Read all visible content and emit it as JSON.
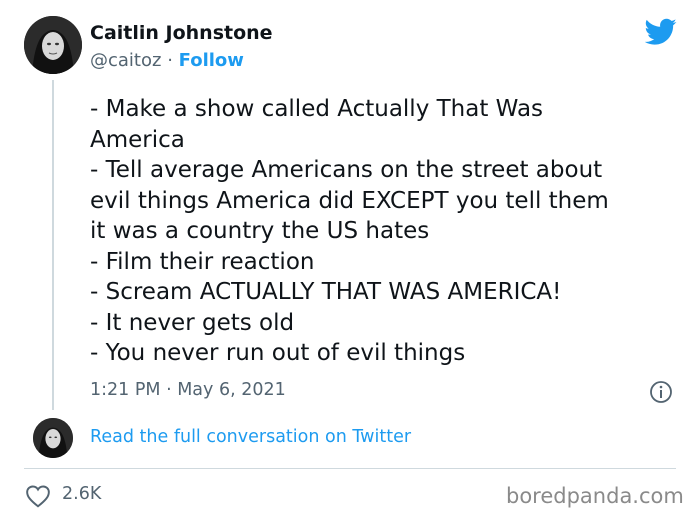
{
  "author": {
    "name": "Caitlin Johnstone",
    "handle": "@caitoz",
    "separator": "·",
    "follow_label": "Follow"
  },
  "icons": {
    "brand": "twitter-bird-icon",
    "info": "info-icon",
    "like": "heart-icon"
  },
  "colors": {
    "twitter_blue": "#1d9bf0",
    "secondary_text": "#536471",
    "primary_text": "#0f1419"
  },
  "tweet": {
    "lines": [
      "- Make a show called Actually That Was",
      "America",
      "- Tell average Americans on the street about",
      "evil things America did EXCEPT you tell them",
      "it was a country the US hates",
      "- Film their reaction",
      "- Scream ACTUALLY THAT WAS AMERICA!",
      "- It never gets old",
      "- You never run out of evil things"
    ],
    "timestamp": "1:21 PM · May 6, 2021"
  },
  "conversation_link": "Read the full conversation on Twitter",
  "likes_count": "2.6K",
  "watermark": "boredpanda.com"
}
